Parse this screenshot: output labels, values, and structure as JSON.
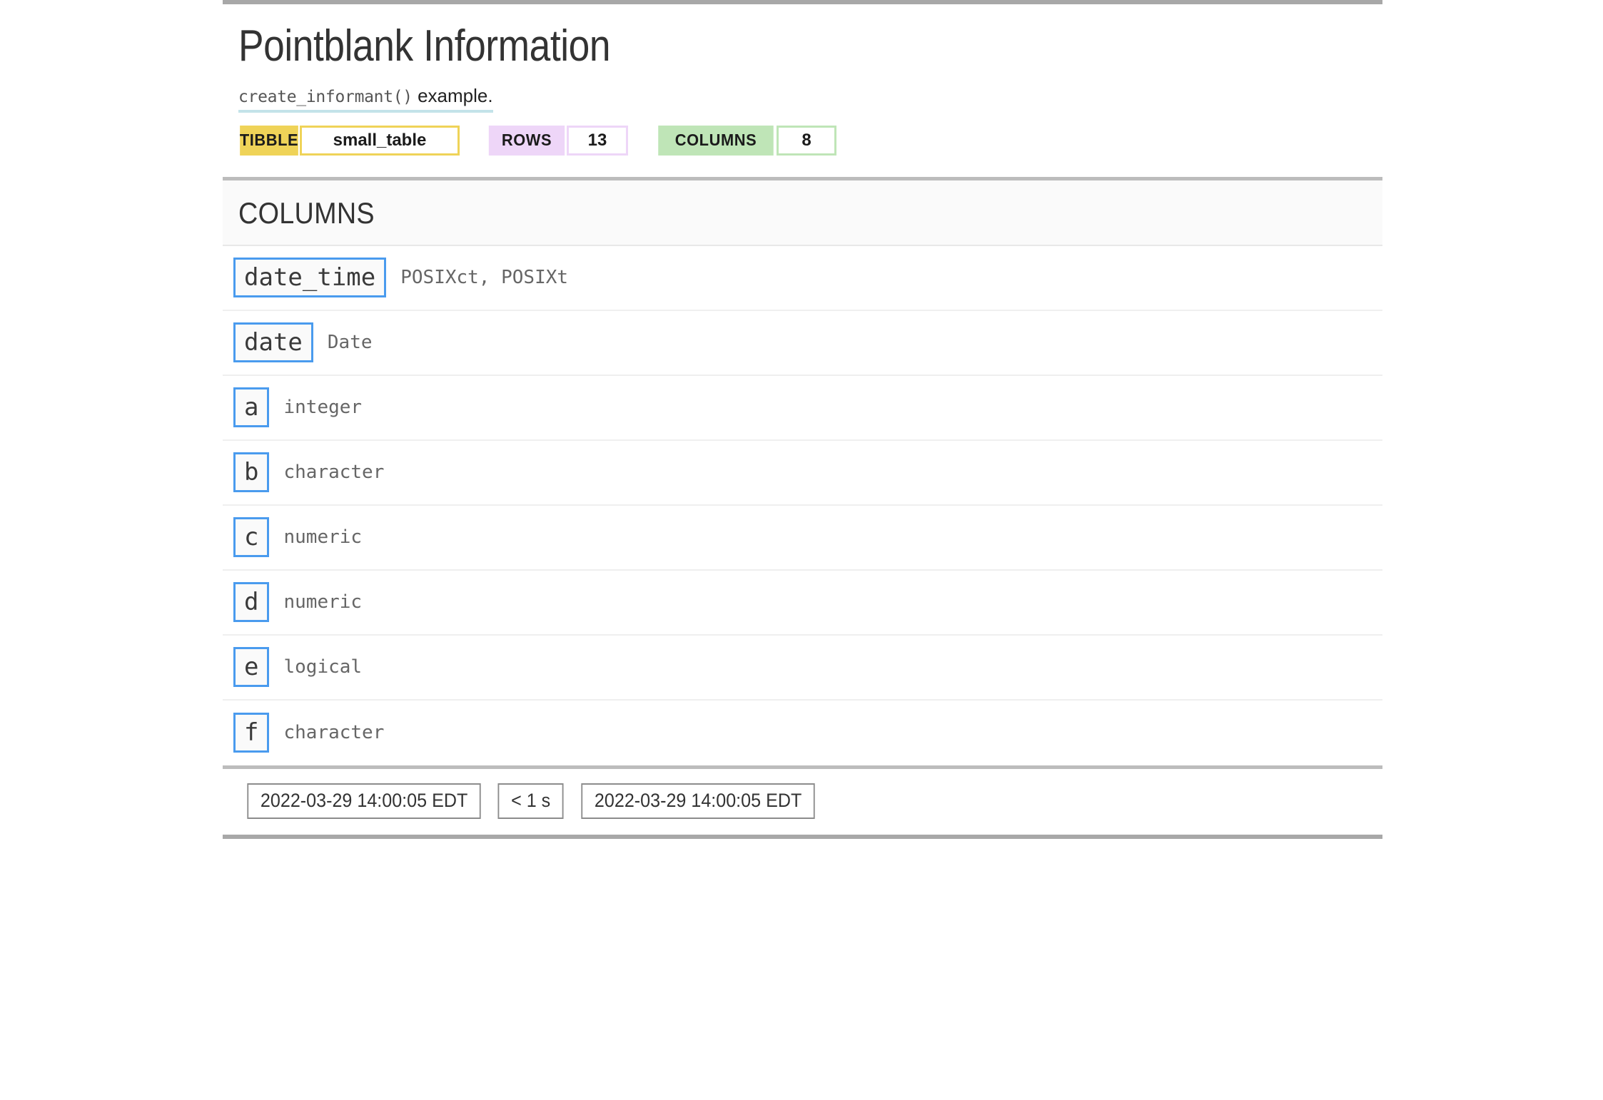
{
  "report": {
    "title": "Pointblank Information",
    "subtitle": {
      "code": "create_informant()",
      "text": " example."
    },
    "badges": [
      {
        "label": "TIBBLE",
        "value": "small_table",
        "color": "#EFD358"
      },
      {
        "label": "ROWS",
        "value": "13",
        "color": "#EED6F8"
      },
      {
        "label": "COLUMNS",
        "value": "8",
        "color": "#BFE5B7"
      }
    ],
    "section": {
      "heading": "COLUMNS",
      "columns": [
        {
          "name": "date_time",
          "type": "POSIXct, POSIXt"
        },
        {
          "name": "date",
          "type": "Date"
        },
        {
          "name": "a",
          "type": "integer"
        },
        {
          "name": "b",
          "type": "character"
        },
        {
          "name": "c",
          "type": "numeric"
        },
        {
          "name": "d",
          "type": "numeric"
        },
        {
          "name": "e",
          "type": "logical"
        },
        {
          "name": "f",
          "type": "character"
        }
      ]
    },
    "footer": {
      "start_time": "2022-03-29 14:00:05 EDT",
      "duration": "< 1 s",
      "end_time": "2022-03-29 14:00:05 EDT"
    },
    "accents": {
      "column_box_border": "#4A9BEE",
      "rule": "#A8A8A8",
      "underline": "#C3E3E9"
    }
  }
}
